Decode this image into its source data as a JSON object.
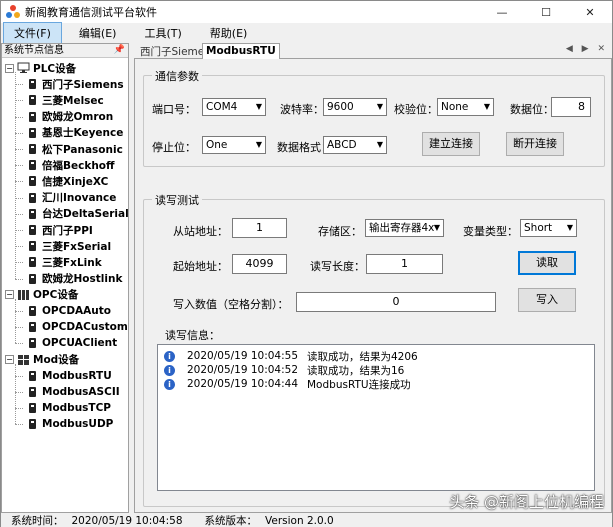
{
  "window": {
    "title": "新阁教育通信测试平台软件",
    "controls": {
      "minimize": "—",
      "maximize": "☐",
      "close": "✕"
    }
  },
  "menubar": {
    "items": [
      "文件(F)",
      "编辑(E)",
      "工具(T)",
      "帮助(E)"
    ]
  },
  "sidebar": {
    "header": "系统节点信息",
    "groups": [
      {
        "label": "PLC设备",
        "icon": "monitor-icon",
        "children": [
          "西门子Siemens",
          "三菱Melsec",
          "欧姆龙Omron",
          "基恩士Keyence",
          "松下Panasonic",
          "倍福Beckhoff",
          "信捷XinjeXC",
          "汇川Inovance",
          "台达DeltaSerial",
          "西门子PPI",
          "三菱FxSerial",
          "三菱FxLink",
          "欧姆龙Hostlink"
        ]
      },
      {
        "label": "OPC设备",
        "icon": "rack-icon",
        "children": [
          "OPCDAAuto",
          "OPCDACustom",
          "OPCUAClient"
        ]
      },
      {
        "label": "Mod设备",
        "icon": "tiles-icon",
        "children": [
          "ModbusRTU",
          "ModbusASCII",
          "ModbusTCP",
          "ModbusUDP"
        ]
      }
    ]
  },
  "tabs": [
    {
      "label": "西门子Siemens",
      "active": false
    },
    {
      "label": "ModbusRTU",
      "active": true
    }
  ],
  "tab_nav": "◀ ▶ ✕",
  "comm": {
    "title": "通信参数",
    "port_label": "端口号：",
    "port_value": "COM4",
    "baud_label": "波特率：",
    "baud_value": "9600",
    "parity_label": "校验位：",
    "parity_value": "None",
    "databits_label": "数据位：",
    "databits_value": "8",
    "stopbits_label": "停止位：",
    "stopbits_value": "One",
    "format_label": "数据格式：",
    "format_value": "ABCD",
    "connect_button": "建立连接",
    "disconnect_button": "断开连接"
  },
  "rw": {
    "title": "读写测试",
    "slave_label": "从站地址：",
    "slave_value": "1",
    "area_label": "存储区：",
    "area_value": "输出寄存器4x",
    "vartype_label": "变量类型：",
    "vartype_value": "Short",
    "start_label": "起始地址：",
    "start_value": "4099",
    "length_label": "读写长度：",
    "length_value": "1",
    "read_button": "读取",
    "write_label": "写入数值（空格分割）：",
    "write_value": "0",
    "write_button": "写入",
    "log_label": "读写信息：",
    "log": [
      {
        "time": "2020/05/19 10:04:55",
        "msg": "读取成功，结果为4206"
      },
      {
        "time": "2020/05/19 10:04:52",
        "msg": "读取成功，结果为16"
      },
      {
        "time": "2020/05/19 10:04:44",
        "msg": "ModbusRTU连接成功"
      }
    ]
  },
  "status": {
    "time_label": "系统时间：",
    "time_value": "2020/05/19 10:04:58",
    "version_label": "系统版本：",
    "version_value": "Version  2.0.0"
  },
  "watermark": "头条 @新阁上位机编程",
  "colors": {
    "menu_active": "#cce4f7",
    "info_icon": "#2b63c6",
    "focus_border": "#0078d7"
  }
}
